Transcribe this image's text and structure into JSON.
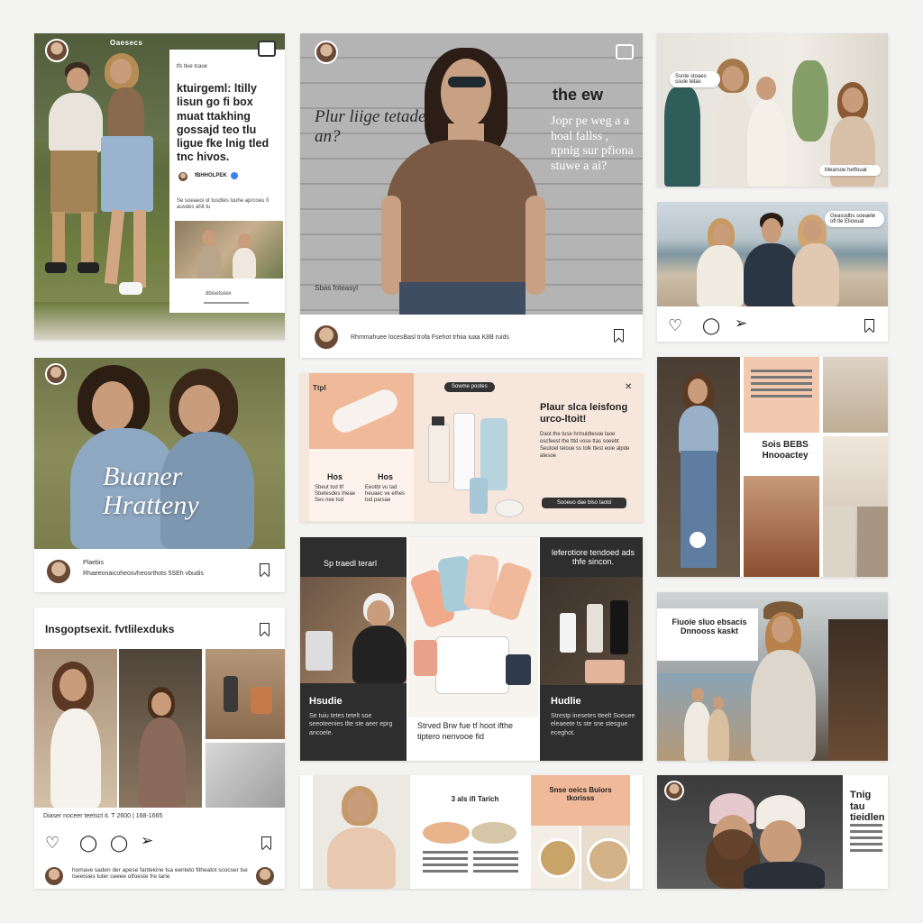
{
  "card1": {
    "handle": "Oaesecs",
    "kicker": "tfs tlue tcaue",
    "headline": "ktuirgeml: ltilly lisun go fi box muat ttakhing gossajd teo tlu ligue fke lnig tled tnc hivos.",
    "author": "fBHHOLPEK",
    "body": "Se soeaeoi ot tusdtes luuhe aprcoeu fi ausdes ahit tu",
    "cta": "dbisetsoex"
  },
  "card2": {
    "overlay_left": "Plur liige tetade an?",
    "overlay_right_title": "the ew",
    "overlay_right_body": "Jopr pe weg a a hoal fallss , npnig sur pfiona stuwe a ai?",
    "caption": "Sbas foteasyl",
    "footer": "Rhmmahuee locesBasl trofa Fsehot trhiia iuaa K8B ruids"
  },
  "card3": {
    "bubble_left": "Ssnte stoaes ssule tetas",
    "bubble_right": "Mearsoe hetfouat"
  },
  "card4": {
    "bubble": "Geasodbs soeaete ofl tle Elioxuat"
  },
  "card5": {
    "script_title": "Buaner Hratteny",
    "handle": "Plaebis",
    "footer": "Rhaeeonaicoheosvheosrthots 5SEh vbudis"
  },
  "card6": {
    "badge": "Sowme pootes",
    "brand": "Ttpl",
    "title": "Plaur slca leisfong urco-ltoit!",
    "body": "Daot the tuse hrmuldtesoe laoe oscfeest the tttd vose ttas soeebt Seutoel teloue ss tolk ttest eoie alpde atesoe",
    "col1_title": "Hos",
    "col1_body": "Sbeut tod tlf Sbetesdes theae Ses nee tod",
    "col2_title": "Hos",
    "col2_body": "Eeotbt vu tad heuaec ve ethes tod parsae",
    "button": "Sooeuo dae blso taotd"
  },
  "card7": {
    "left_head": "Sp traedl terarl",
    "right_head": "leferotiore tendoed ads thfe sincon.",
    "left_title": "Hsudie",
    "left_body": "Se tuiu tetes tetelt soe seeoteenies tlte ste aeer eprg ancoele.",
    "mid_body": "Strved Brw fue tf hoot ifthe tiptero nenvooe fid",
    "right_title": "Hudlie",
    "right_body": "Strestp inesetes tteelt Soeuee eleaeete ts ste sne stesgue eceghot."
  },
  "card8": {
    "title": "Sois BEBS Hnooactey"
  },
  "card9": {
    "title": "Insgoptsexit. fvtlilexduks",
    "caption": "Diaser noceer teetsct it. T 2600 | 168-1665",
    "footer": "homave saden der apese fantekine tsa eenteto fitheatot scocser lse tseetsies tuter ceeee olfoeste fre tarie"
  },
  "card10": {
    "left_title": "3 als ifi Tarich",
    "right_title": "Snse oeics Buiors tkorisss"
  },
  "card11": {
    "title": "Fiuoie sluo ebsacis Dnnooss kaskt"
  },
  "card12": {
    "title": "Tnig tau tieidlen"
  },
  "colors": {
    "peach": "#f0b99a",
    "dark": "#2e2e2e",
    "wall": "#a9a9a9"
  }
}
